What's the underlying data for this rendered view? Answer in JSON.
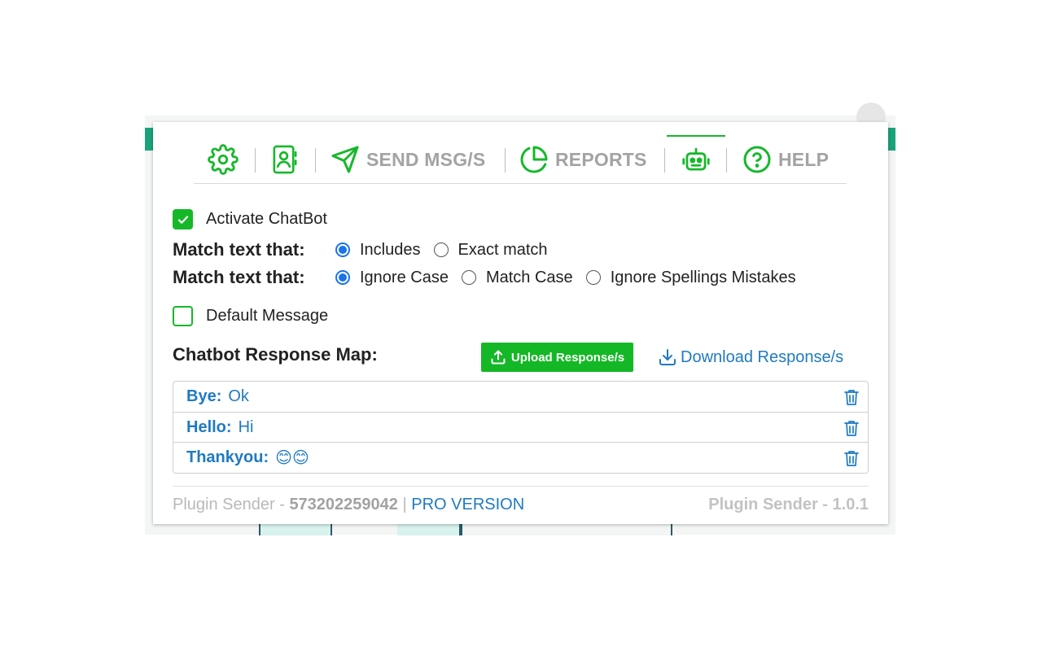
{
  "tabs": {
    "send_label": "SEND MSG/S",
    "reports_label": "REPORTS",
    "help_label": "HELP"
  },
  "chatbot": {
    "activate_label": "Activate ChatBot",
    "activate_checked": true,
    "match_mode_title": "Match text that:",
    "match_mode_options": [
      "Includes",
      "Exact match"
    ],
    "match_mode_selected": "Includes",
    "case_mode_title": "Match text that:",
    "case_mode_options": [
      "Ignore Case",
      "Match Case",
      "Ignore Spellings Mistakes"
    ],
    "case_mode_selected": "Ignore Case",
    "default_message_label": "Default Message",
    "default_message_checked": false,
    "response_map_title": "Chatbot Response Map:",
    "upload_label": "Upload Response/s",
    "download_label": "Download Response/s",
    "responses": [
      {
        "key": "Bye:",
        "value": "Ok"
      },
      {
        "key": "Hello:",
        "value": "Hi"
      },
      {
        "key": "Thankyou:",
        "value": "😊😊"
      }
    ]
  },
  "footer": {
    "brand": "Plugin Sender -",
    "number": "573202259042",
    "divider": "|",
    "pro_label": "PRO VERSION",
    "version": "Plugin Sender - 1.0.1"
  },
  "colors": {
    "accent_green": "#16b82a",
    "link_blue": "#1f7ac2",
    "radio_blue": "#1a73e8",
    "tab_gray": "#a3a3a3"
  },
  "icons": {
    "settings": "gear-icon",
    "contacts": "contact-card-icon",
    "send": "paper-plane-icon",
    "reports": "pie-chart-icon",
    "chatbot": "robot-icon",
    "help": "question-circle-icon",
    "upload": "upload-icon",
    "download": "download-icon",
    "delete": "trash-icon"
  }
}
